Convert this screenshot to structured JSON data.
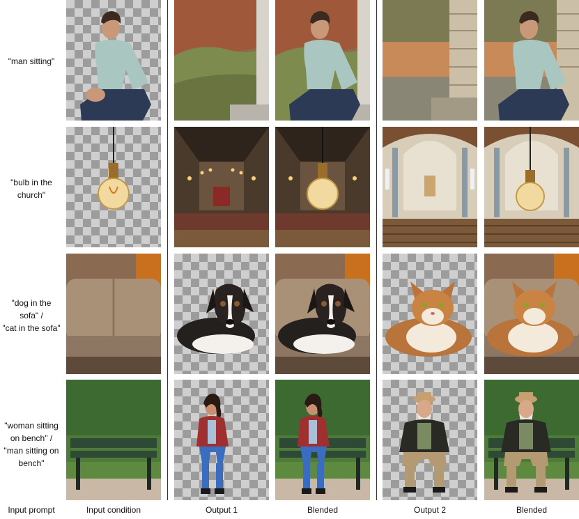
{
  "prompts": {
    "row1": [
      "\"man sitting\""
    ],
    "row2": [
      "\"bulb in the",
      "church\""
    ],
    "row3": [
      "\"dog in the",
      "sofa\" /",
      "\"cat in the sofa\""
    ],
    "row4": [
      "\"woman  sitting",
      "on bench\" /",
      "\"man  sitting on",
      "bench\""
    ]
  },
  "captions": {
    "input_prompt": "Input prompt",
    "input_condition": "Input condition",
    "output1": "Output 1",
    "blended1": "Blended",
    "output2": "Output 2",
    "blended2": "Blended"
  }
}
